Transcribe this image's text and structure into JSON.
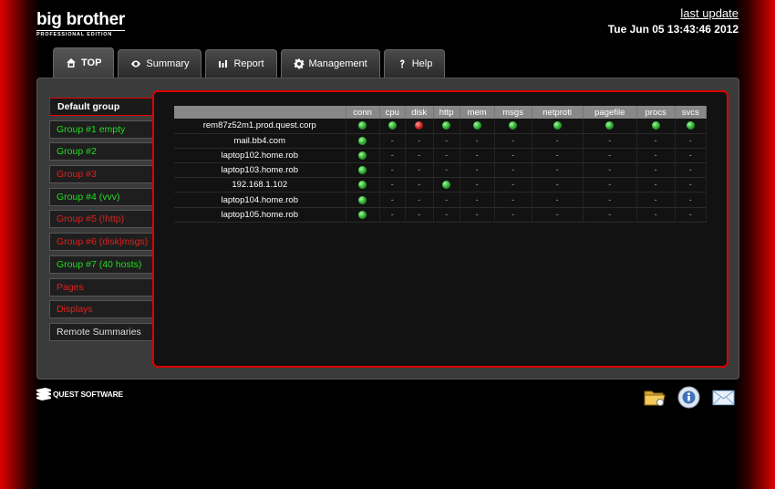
{
  "brand": {
    "name": "big brother",
    "edition": "PROFESSIONAL EDITION"
  },
  "last_update": {
    "label": "last update",
    "time": "Tue Jun 05 13:43:46 2012"
  },
  "tabs": [
    {
      "label": "TOP",
      "icon": "home-icon",
      "active": true
    },
    {
      "label": "Summary",
      "icon": "eye-icon",
      "active": false
    },
    {
      "label": "Report",
      "icon": "bar-chart-icon",
      "active": false
    },
    {
      "label": "Management",
      "icon": "gear-icon",
      "active": false
    },
    {
      "label": "Help",
      "icon": "question-icon",
      "active": false
    }
  ],
  "groups": [
    {
      "label": "Default group",
      "color": "#ffffff",
      "selected": true
    },
    {
      "label": "Group #1 empty",
      "color": "#22dd22"
    },
    {
      "label": "Group #2",
      "color": "#22dd22"
    },
    {
      "label": "Group #3",
      "color": "#e02020"
    },
    {
      "label": "Group #4 (vvv)",
      "color": "#22dd22"
    },
    {
      "label": "Group #5 (!http)",
      "color": "#e02020"
    },
    {
      "label": "Group #6 (disk|msgs)",
      "color": "#e02020"
    },
    {
      "label": "Group #7 (40 hosts)",
      "color": "#22dd22"
    },
    {
      "label": "Pages",
      "color": "#e02020"
    },
    {
      "label": "Displays",
      "color": "#e02020"
    },
    {
      "label": "Remote Summaries",
      "color": "#dddddd"
    }
  ],
  "table": {
    "columns": [
      "conn",
      "cpu",
      "disk",
      "http",
      "mem",
      "msgs",
      "netproti",
      "pagefile",
      "procs",
      "svcs"
    ],
    "rows": [
      {
        "host": "rem87z52m1.prod.quest.corp",
        "status": [
          "green",
          "green",
          "red",
          "green",
          "green",
          "green",
          "green",
          "green",
          "green",
          "green"
        ]
      },
      {
        "host": "mail.bb4.com",
        "status": [
          "green",
          "-",
          "-",
          "-",
          "-",
          "-",
          "-",
          "-",
          "-",
          "-"
        ]
      },
      {
        "host": "laptop102.home.rob",
        "status": [
          "green",
          "-",
          "-",
          "-",
          "-",
          "-",
          "-",
          "-",
          "-",
          "-"
        ]
      },
      {
        "host": "laptop103.home.rob",
        "status": [
          "green",
          "-",
          "-",
          "-",
          "-",
          "-",
          "-",
          "-",
          "-",
          "-"
        ]
      },
      {
        "host": "192.168.1.102",
        "status": [
          "green",
          "-",
          "-",
          "green",
          "-",
          "-",
          "-",
          "-",
          "-",
          "-"
        ]
      },
      {
        "host": "laptop104.home.rob",
        "status": [
          "green",
          "-",
          "-",
          "-",
          "-",
          "-",
          "-",
          "-",
          "-",
          "-"
        ]
      },
      {
        "host": "laptop105.home.rob",
        "status": [
          "green",
          "-",
          "-",
          "-",
          "-",
          "-",
          "-",
          "-",
          "-",
          "-"
        ]
      }
    ]
  },
  "footer": {
    "quest_logo": "QUEST SOFTWARE",
    "icons": [
      "folder-icon",
      "info-icon",
      "mail-icon"
    ]
  },
  "colors": {
    "accent_red": "#dd0000",
    "ok_green": "#33aa33",
    "alert_red": "#cc2222"
  }
}
